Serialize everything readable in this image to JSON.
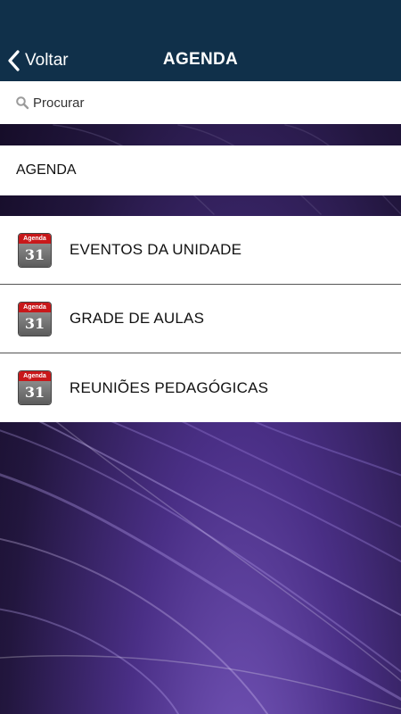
{
  "header": {
    "back_label": "Voltar",
    "title": "AGENDA"
  },
  "search": {
    "placeholder": "Procurar",
    "value": ""
  },
  "section": {
    "title": "AGENDA"
  },
  "menu": {
    "items": [
      {
        "label": "EVENTOS DA UNIDADE",
        "icon": "calendar-icon",
        "icon_caption": "Agenda",
        "icon_day": "31"
      },
      {
        "label": "GRADE DE AULAS",
        "icon": "calendar-icon",
        "icon_caption": "Agenda",
        "icon_day": "31"
      },
      {
        "label": "REUNIÕES PEDAGÓGICAS",
        "icon": "calendar-icon",
        "icon_caption": "Agenda",
        "icon_day": "31"
      }
    ]
  },
  "colors": {
    "navbar": "#10304a",
    "calendar_red": "#c8181a",
    "background_accent": "#7a5bc0"
  }
}
